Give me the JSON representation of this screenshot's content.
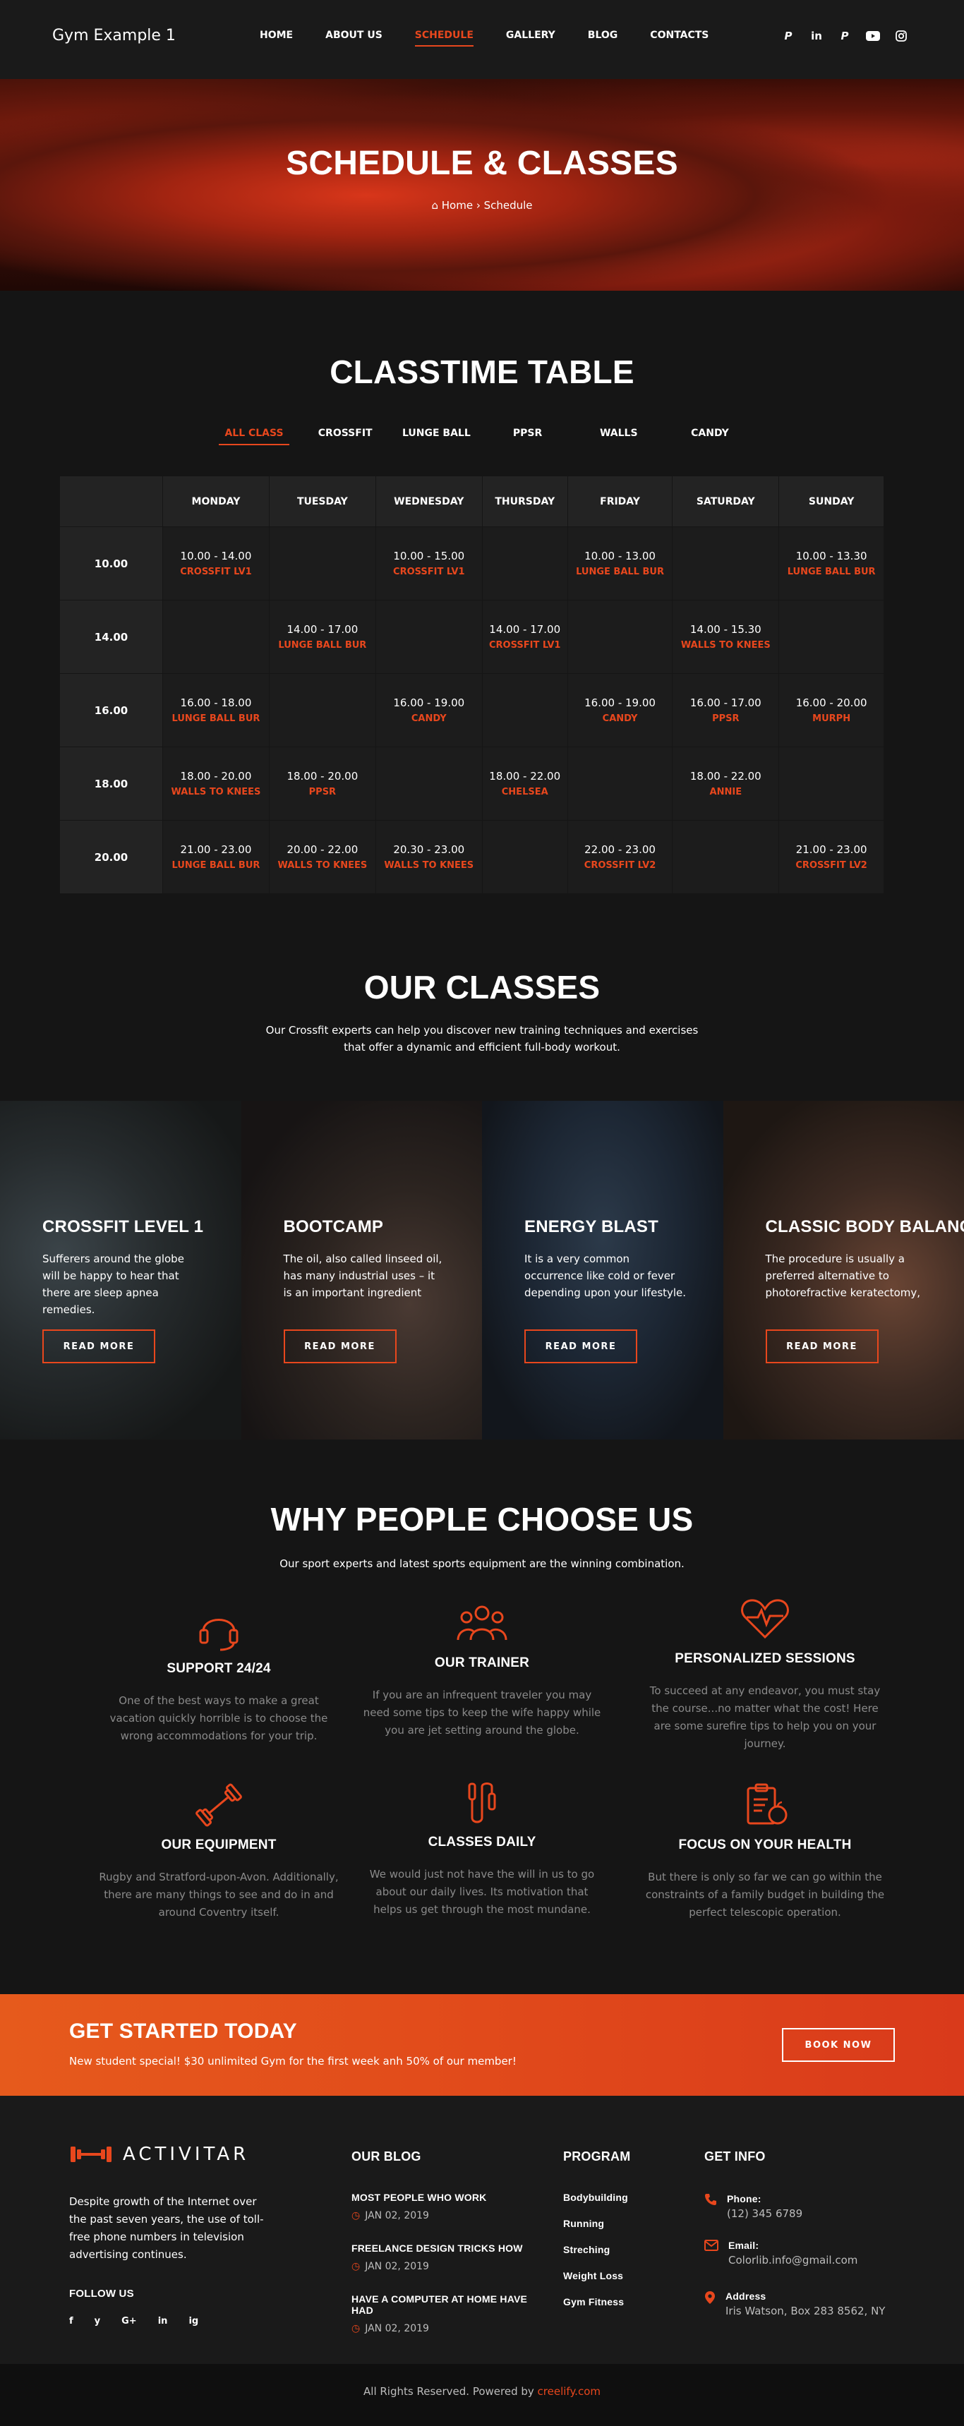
{
  "header": {
    "logo": "Gym Example 1",
    "nav": [
      "HOME",
      "ABOUT US",
      "SCHEDULE",
      "GALLERY",
      "BLOG",
      "CONTACTS"
    ],
    "active_nav": "SCHEDULE",
    "socials": [
      "pinterest-icon",
      "linkedin-icon",
      "pinterest-icon",
      "youtube-icon",
      "instagram-icon"
    ]
  },
  "hero": {
    "title": "SCHEDULE & CLASSES",
    "breadcrumb_home": "Home",
    "breadcrumb_sep": "›",
    "breadcrumb_current": "Schedule"
  },
  "classtime": {
    "title": "CLASSTIME TABLE",
    "filters": [
      "ALL CLASS",
      "CROSSFIT",
      "LUNGE BALL",
      "PPSR",
      "WALLS",
      "CANDY"
    ],
    "days": [
      "MONDAY",
      "TUESDAY",
      "WEDNESDAY",
      "THURSDAY",
      "FRIDAY",
      "SATURDAY",
      "SUNDAY"
    ],
    "rows": [
      {
        "time": "10.00",
        "cells": [
          {
            "t": "10.00 - 14.00",
            "c": "CROSSFIT LV1"
          },
          {
            "t": "",
            "c": ""
          },
          {
            "t": "10.00 - 15.00",
            "c": "CROSSFIT LV1"
          },
          {
            "t": "",
            "c": ""
          },
          {
            "t": "10.00 - 13.00",
            "c": "LUNGE BALL BUR"
          },
          {
            "t": "",
            "c": ""
          },
          {
            "t": "10.00 - 13.30",
            "c": "LUNGE BALL BUR"
          }
        ]
      },
      {
        "time": "14.00",
        "cells": [
          {
            "t": "",
            "c": ""
          },
          {
            "t": "14.00 - 17.00",
            "c": "LUNGE BALL BUR"
          },
          {
            "t": "",
            "c": ""
          },
          {
            "t": "14.00 - 17.00",
            "c": "CROSSFIT LV1"
          },
          {
            "t": "",
            "c": ""
          },
          {
            "t": "14.00 - 15.30",
            "c": "WALLS TO KNEES"
          },
          {
            "t": "",
            "c": ""
          }
        ]
      },
      {
        "time": "16.00",
        "cells": [
          {
            "t": "16.00 - 18.00",
            "c": "LUNGE BALL BUR"
          },
          {
            "t": "",
            "c": ""
          },
          {
            "t": "16.00 - 19.00",
            "c": "CANDY"
          },
          {
            "t": "",
            "c": ""
          },
          {
            "t": "16.00 - 19.00",
            "c": "CANDY"
          },
          {
            "t": "16.00 - 17.00",
            "c": "PPSR"
          },
          {
            "t": "16.00 - 20.00",
            "c": "MURPH"
          }
        ]
      },
      {
        "time": "18.00",
        "cells": [
          {
            "t": "18.00 - 20.00",
            "c": "WALLS TO KNEES"
          },
          {
            "t": "18.00 - 20.00",
            "c": "PPSR"
          },
          {
            "t": "",
            "c": ""
          },
          {
            "t": "18.00 - 22.00",
            "c": "CHELSEA"
          },
          {
            "t": "",
            "c": ""
          },
          {
            "t": "18.00 - 22.00",
            "c": "ANNIE"
          },
          {
            "t": "",
            "c": ""
          }
        ]
      },
      {
        "time": "20.00",
        "cells": [
          {
            "t": "21.00 - 23.00",
            "c": "LUNGE BALL BUR"
          },
          {
            "t": "20.00 - 22.00",
            "c": "WALLS TO KNEES"
          },
          {
            "t": "20.30 - 23.00",
            "c": "WALLS TO KNEES"
          },
          {
            "t": "",
            "c": ""
          },
          {
            "t": "22.00 - 23.00",
            "c": "CROSSFIT LV2"
          },
          {
            "t": "",
            "c": ""
          },
          {
            "t": "21.00 - 23.00",
            "c": "CROSSFIT LV2"
          }
        ]
      }
    ]
  },
  "classes": {
    "title": "OUR CLASSES",
    "subtitle_1": "Our Crossfit experts can help you discover new training techniques and exercises",
    "subtitle_2": "that offer a dynamic and efficient full-body workout.",
    "items": [
      {
        "name": "CROSSFIT LEVEL 1",
        "desc": "Sufferers around the globe will be happy to hear that there are sleep apnea remedies.",
        "btn": "READ MORE"
      },
      {
        "name": "BOOTCAMP",
        "desc": "The oil, also called linseed oil, has many industrial uses – it is an important ingredient",
        "btn": "READ MORE"
      },
      {
        "name": "ENERGY BLAST",
        "desc": "It is a very common occurrence like cold or fever depending upon your lifestyle.",
        "btn": "READ MORE"
      },
      {
        "name": "CLASSIC BODY BALANCE",
        "desc": "The procedure is usually a preferred alternative to photorefractive keratectomy,",
        "btn": "READ MORE"
      }
    ]
  },
  "why": {
    "title": "WHY PEOPLE CHOOSE US",
    "subtitle": "Our sport experts and latest sports equipment are the winning combination.",
    "items": [
      {
        "icon": "headset-icon",
        "title": "SUPPORT 24/24",
        "desc": "One of the best ways to make a great vacation quickly horrible is to choose the wrong accommodations for your trip."
      },
      {
        "icon": "team-icon",
        "title": "OUR TRAINER",
        "desc": "If you are an infrequent traveler you may need some tips to keep the wife happy while you are jet setting around the globe."
      },
      {
        "icon": "heart-pulse-icon",
        "title": "PERSONALIZED SESSIONS",
        "desc": "To succeed at any endeavor, you must stay the course...no matter what the cost! Here are some surefire tips to help you on your journey."
      },
      {
        "icon": "dumbbell-icon",
        "title": "OUR EQUIPMENT",
        "desc": "Rugby and Stratford-upon-Avon. Additionally, there are many things to see and do in and around Coventry itself."
      },
      {
        "icon": "jump-rope-icon",
        "title": "CLASSES DAILY",
        "desc": "We would just not have the will in us to go about our daily lives. Its motivation that helps us get through the most mundane."
      },
      {
        "icon": "clipboard-apple-icon",
        "title": "FOCUS ON YOUR HEALTH",
        "desc": "But there is only so far we can go within the constraints of a family budget in building the perfect telescopic operation."
      }
    ]
  },
  "cta": {
    "title": "GET STARTED TODAY",
    "subtitle": "New student special! $30 unlimited Gym for the first week anh 50% of our member!",
    "button": "BOOK NOW"
  },
  "footer": {
    "brand": "ACTIVITAR",
    "about": "Despite growth of the Internet over the past seven years, the use of toll-free phone numbers in television advertising continues.",
    "follow": "FOLLOW US",
    "follow_icons": [
      "f",
      "y",
      "G+",
      "in",
      "ig"
    ],
    "blog_title": "OUR BLOG",
    "posts": [
      {
        "title": "MOST PEOPLE WHO WORK",
        "date": "JAN 02, 2019"
      },
      {
        "title": "FREELANCE DESIGN TRICKS HOW",
        "date": "JAN 02, 2019"
      },
      {
        "title": "HAVE A COMPUTER AT HOME HAVE HAD",
        "date": "JAN 02, 2019"
      }
    ],
    "program_title": "PROGRAM",
    "programs": [
      "Bodybuilding",
      "Running",
      "Streching",
      "Weight Loss",
      "Gym Fitness"
    ],
    "info_title": "GET INFO",
    "info": [
      {
        "icon": "phone-icon",
        "label": "Phone:",
        "value": "(12) 345 6789"
      },
      {
        "icon": "email-icon",
        "label": "Email:",
        "value": "Colorlib.info@gmail.com"
      },
      {
        "icon": "map-pin-icon",
        "label": "Address",
        "value": "Iris Watson, Box 283 8562, NY"
      }
    ],
    "copyright": "All Rights Reserved. Powered by",
    "copyright_link": "creelify.com"
  },
  "colors": {
    "accent": "#e8471d",
    "bg": "#151515",
    "panel": "#1c1c1c"
  }
}
